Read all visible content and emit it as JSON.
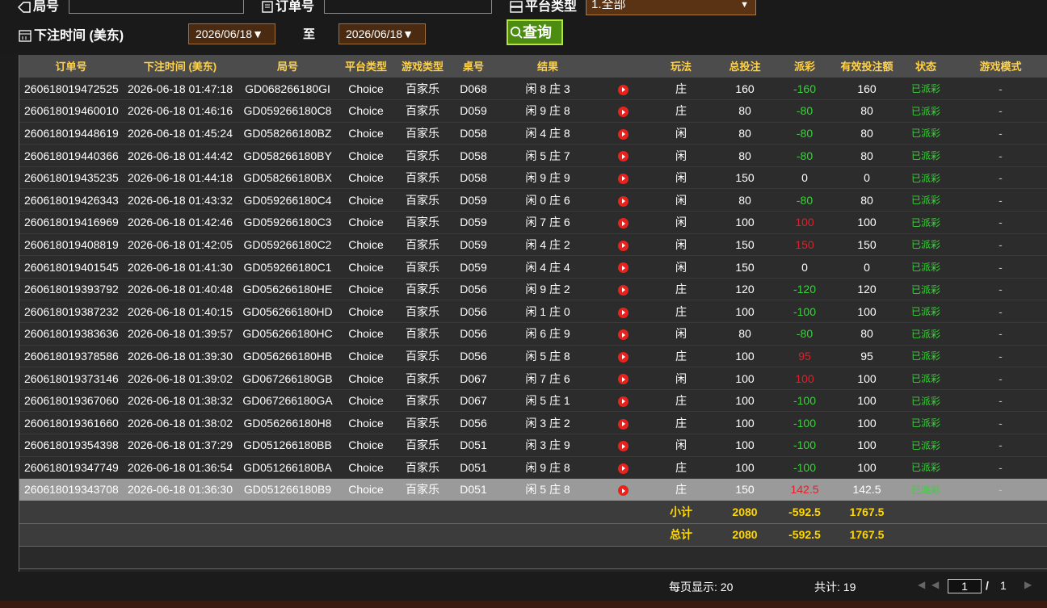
{
  "filters": {
    "round_label": "局号",
    "order_label": "订单号",
    "platform_label": "平台类型",
    "platform_value": "1.全部",
    "time_label": "下注时间 (美东)",
    "date_from": "2026/06/18▼",
    "to_label": "至",
    "date_to": "2026/06/18▼",
    "query_button": "查询"
  },
  "table": {
    "headers": [
      "订单号",
      "下注时间 (美东)",
      "局号",
      "平台类型",
      "游戏类型",
      "桌号",
      "结果",
      "",
      "玩法",
      "总投注",
      "派彩",
      "有效投注额",
      "状态",
      "游戏模式"
    ],
    "rows": [
      {
        "order": "260618019472525",
        "time": "2026-06-18 01:47:18",
        "round": "GD068266180GI",
        "platform": "Choice",
        "game": "百家乐",
        "table": "D068",
        "result": "闲 8 庄 3",
        "play": "庄",
        "bet": "160",
        "payout": "-160",
        "valid": "160",
        "status": "已派彩",
        "mode": "-"
      },
      {
        "order": "260618019460010",
        "time": "2026-06-18 01:46:16",
        "round": "GD059266180C8",
        "platform": "Choice",
        "game": "百家乐",
        "table": "D059",
        "result": "闲 9 庄 8",
        "play": "庄",
        "bet": "80",
        "payout": "-80",
        "valid": "80",
        "status": "已派彩",
        "mode": "-"
      },
      {
        "order": "260618019448619",
        "time": "2026-06-18 01:45:24",
        "round": "GD058266180BZ",
        "platform": "Choice",
        "game": "百家乐",
        "table": "D058",
        "result": "闲 4 庄 8",
        "play": "闲",
        "bet": "80",
        "payout": "-80",
        "valid": "80",
        "status": "已派彩",
        "mode": "-"
      },
      {
        "order": "260618019440366",
        "time": "2026-06-18 01:44:42",
        "round": "GD058266180BY",
        "platform": "Choice",
        "game": "百家乐",
        "table": "D058",
        "result": "闲 5 庄 7",
        "play": "闲",
        "bet": "80",
        "payout": "-80",
        "valid": "80",
        "status": "已派彩",
        "mode": "-"
      },
      {
        "order": "260618019435235",
        "time": "2026-06-18 01:44:18",
        "round": "GD058266180BX",
        "platform": "Choice",
        "game": "百家乐",
        "table": "D058",
        "result": "闲 9 庄 9",
        "play": "闲",
        "bet": "150",
        "payout": "0",
        "valid": "0",
        "status": "已派彩",
        "mode": "-"
      },
      {
        "order": "260618019426343",
        "time": "2026-06-18 01:43:32",
        "round": "GD059266180C4",
        "platform": "Choice",
        "game": "百家乐",
        "table": "D059",
        "result": "闲 0 庄 6",
        "play": "闲",
        "bet": "80",
        "payout": "-80",
        "valid": "80",
        "status": "已派彩",
        "mode": "-"
      },
      {
        "order": "260618019416969",
        "time": "2026-06-18 01:42:46",
        "round": "GD059266180C3",
        "platform": "Choice",
        "game": "百家乐",
        "table": "D059",
        "result": "闲 7 庄 6",
        "play": "闲",
        "bet": "100",
        "payout": "100",
        "valid": "100",
        "status": "已派彩",
        "mode": "-"
      },
      {
        "order": "260618019408819",
        "time": "2026-06-18 01:42:05",
        "round": "GD059266180C2",
        "platform": "Choice",
        "game": "百家乐",
        "table": "D059",
        "result": "闲 4 庄 2",
        "play": "闲",
        "bet": "150",
        "payout": "150",
        "valid": "150",
        "status": "已派彩",
        "mode": "-"
      },
      {
        "order": "260618019401545",
        "time": "2026-06-18 01:41:30",
        "round": "GD059266180C1",
        "platform": "Choice",
        "game": "百家乐",
        "table": "D059",
        "result": "闲 4 庄 4",
        "play": "闲",
        "bet": "150",
        "payout": "0",
        "valid": "0",
        "status": "已派彩",
        "mode": "-"
      },
      {
        "order": "260618019393792",
        "time": "2026-06-18 01:40:48",
        "round": "GD056266180HE",
        "platform": "Choice",
        "game": "百家乐",
        "table": "D056",
        "result": "闲 9 庄 2",
        "play": "庄",
        "bet": "120",
        "payout": "-120",
        "valid": "120",
        "status": "已派彩",
        "mode": "-"
      },
      {
        "order": "260618019387232",
        "time": "2026-06-18 01:40:15",
        "round": "GD056266180HD",
        "platform": "Choice",
        "game": "百家乐",
        "table": "D056",
        "result": "闲 1 庄 0",
        "play": "庄",
        "bet": "100",
        "payout": "-100",
        "valid": "100",
        "status": "已派彩",
        "mode": "-"
      },
      {
        "order": "260618019383636",
        "time": "2026-06-18 01:39:57",
        "round": "GD056266180HC",
        "platform": "Choice",
        "game": "百家乐",
        "table": "D056",
        "result": "闲 6 庄 9",
        "play": "闲",
        "bet": "80",
        "payout": "-80",
        "valid": "80",
        "status": "已派彩",
        "mode": "-"
      },
      {
        "order": "260618019378586",
        "time": "2026-06-18 01:39:30",
        "round": "GD056266180HB",
        "platform": "Choice",
        "game": "百家乐",
        "table": "D056",
        "result": "闲 5 庄 8",
        "play": "庄",
        "bet": "100",
        "payout": "95",
        "valid": "95",
        "status": "已派彩",
        "mode": "-"
      },
      {
        "order": "260618019373146",
        "time": "2026-06-18 01:39:02",
        "round": "GD067266180GB",
        "platform": "Choice",
        "game": "百家乐",
        "table": "D067",
        "result": "闲 7 庄 6",
        "play": "闲",
        "bet": "100",
        "payout": "100",
        "valid": "100",
        "status": "已派彩",
        "mode": "-"
      },
      {
        "order": "260618019367060",
        "time": "2026-06-18 01:38:32",
        "round": "GD067266180GA",
        "platform": "Choice",
        "game": "百家乐",
        "table": "D067",
        "result": "闲 5 庄 1",
        "play": "庄",
        "bet": "100",
        "payout": "-100",
        "valid": "100",
        "status": "已派彩",
        "mode": "-"
      },
      {
        "order": "260618019361660",
        "time": "2026-06-18 01:38:02",
        "round": "GD056266180H8",
        "platform": "Choice",
        "game": "百家乐",
        "table": "D056",
        "result": "闲 3 庄 2",
        "play": "庄",
        "bet": "100",
        "payout": "-100",
        "valid": "100",
        "status": "已派彩",
        "mode": "-"
      },
      {
        "order": "260618019354398",
        "time": "2026-06-18 01:37:29",
        "round": "GD051266180BB",
        "platform": "Choice",
        "game": "百家乐",
        "table": "D051",
        "result": "闲 3 庄 9",
        "play": "闲",
        "bet": "100",
        "payout": "-100",
        "valid": "100",
        "status": "已派彩",
        "mode": "-"
      },
      {
        "order": "260618019347749",
        "time": "2026-06-18 01:36:54",
        "round": "GD051266180BA",
        "platform": "Choice",
        "game": "百家乐",
        "table": "D051",
        "result": "闲 9 庄 8",
        "play": "庄",
        "bet": "100",
        "payout": "-100",
        "valid": "100",
        "status": "已派彩",
        "mode": "-"
      },
      {
        "order": "260618019343708",
        "time": "2026-06-18 01:36:30",
        "round": "GD051266180B9",
        "platform": "Choice",
        "game": "百家乐",
        "table": "D051",
        "result": "闲 5 庄 8",
        "play": "庄",
        "bet": "150",
        "payout": "142.5",
        "valid": "142.5",
        "status": "已派彩",
        "mode": "-"
      }
    ],
    "selected_row": 18,
    "subtotal": {
      "label": "小计",
      "bet": "2080",
      "payout": "-592.5",
      "valid": "1767.5"
    },
    "total": {
      "label": "总计",
      "bet": "2080",
      "payout": "-592.5",
      "valid": "1767.5"
    }
  },
  "pager": {
    "per_page": "每页显示: 20",
    "count": "共计: 19",
    "first": "◀",
    "prev": "◀",
    "page": "1",
    "of": "/",
    "pages": "1",
    "next": "▶"
  },
  "colors": {
    "header_text": "#ffd24a",
    "negative": "#3ad23a",
    "positive": "#e0202a",
    "button": "#4c8d11"
  }
}
